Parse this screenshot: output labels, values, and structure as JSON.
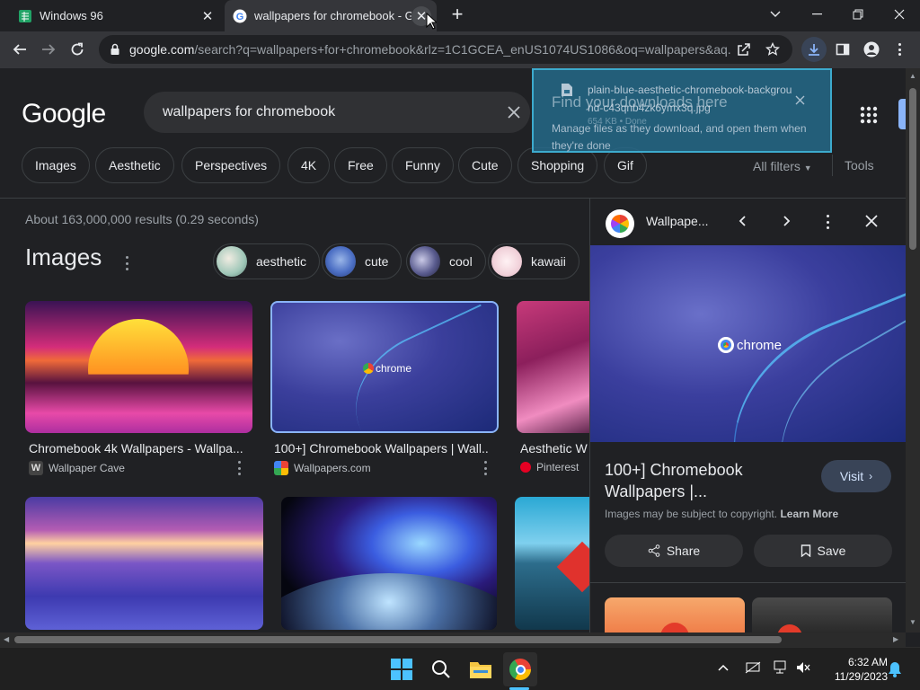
{
  "tabs": [
    {
      "title": "Windows 96",
      "active": false
    },
    {
      "title": "wallpapers for chromebook - Google Search",
      "active": true
    }
  ],
  "toolbar": {
    "url_host": "google.com",
    "url_rest": "/search?q=wallpapers+for+chromebook&rlz=1C1GCEA_enUS1074US1086&oq=wallpapers&aq..."
  },
  "search": {
    "logo": "Google",
    "query": "wallpapers for chromebook",
    "filters": [
      "Images",
      "Aesthetic",
      "Perspectives",
      "4K",
      "Free",
      "Funny",
      "Cute",
      "Shopping",
      "Gif"
    ],
    "all_filters": "All filters",
    "tools": "Tools",
    "stats": "About 163,000,000 results (0.29 seconds)"
  },
  "images_section": {
    "title": "Images",
    "related": [
      "aesthetic",
      "cute",
      "cool",
      "kawaii"
    ],
    "results": [
      {
        "caption": "Chromebook 4k Wallpapers - Wallpa...",
        "source": "Wallpaper Cave"
      },
      {
        "caption": "100+] Chromebook Wallpapers | Wall...",
        "source": "Wallpapers.com"
      },
      {
        "caption": "Aesthetic W",
        "source": "Pinterest"
      }
    ],
    "thumb_label": "chrome"
  },
  "panel": {
    "site": "Wallpape...",
    "image_label": "chrome",
    "title": "100+] Chromebook Wallpapers |...",
    "visit": "Visit",
    "copyright": "Images may be subject to copyright.",
    "learn_more": "Learn More",
    "share": "Share",
    "save": "Save"
  },
  "download": {
    "filename": "plain-blue-aesthetic-chromebook-background-c43qnb4zk6ymx3q.jpg",
    "overlay_text": "Find your downloads here",
    "size": "654 KB • Done",
    "message": "Manage files as they download, and open them when they're done"
  },
  "taskbar": {
    "time": "6:32 AM",
    "date": "11/29/2023"
  },
  "colors": {
    "background": "#202124",
    "toolbar": "#35363a",
    "chip_border": "#3c4043",
    "download_bubble": "#246b8c",
    "visit_button": "#394457"
  }
}
